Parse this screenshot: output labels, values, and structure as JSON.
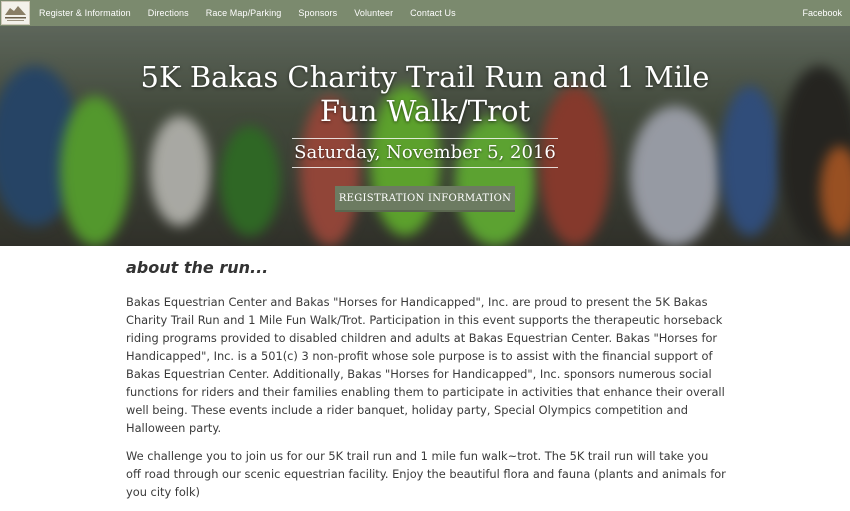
{
  "nav": {
    "items": [
      "Register & Information",
      "Directions",
      "Race Map/Parking",
      "Sponsors",
      "Volunteer",
      "Contact Us"
    ],
    "right_link": "Facebook",
    "logo_icon": "horses-for-handicapped-logo"
  },
  "hero": {
    "title_line1": "5K Bakas Charity Trail Run and 1 Mile",
    "title_line2": "Fun Walk/Trot",
    "date": "Saturday, November 5, 2016",
    "button_label": "REGISTRATION INFORMATION",
    "accent_color": "#6c7b61"
  },
  "about": {
    "title": "about the run...",
    "paragraph1": "Bakas Equestrian Center and Bakas \"Horses for Handicapped\", Inc. are proud to present the 5K Bakas Charity Trail Run and 1 Mile Fun Walk/Trot. Participation in this event supports the therapeutic horseback riding programs provided to disabled children and adults at Bakas Equestrian Center. Bakas \"Horses for Handicapped\", Inc. is a 501(c) 3 non-profit whose sole purpose is to assist with the financial support of Bakas Equestrian Center. Additionally, Bakas \"Horses for Handicapped\", Inc. sponsors numerous social functions for riders and their families enabling them to participate in activities that enhance their overall well being. These events include a rider banquet, holiday party, Special Olympics competition and Halloween party.",
    "paragraph2": "We challenge you to join us for our 5K trail run and 1 mile fun walk~trot. The 5K trail run will take you off road through our scenic equestrian facility. Enjoy the beautiful flora and fauna (plants and animals for you city folk)"
  }
}
